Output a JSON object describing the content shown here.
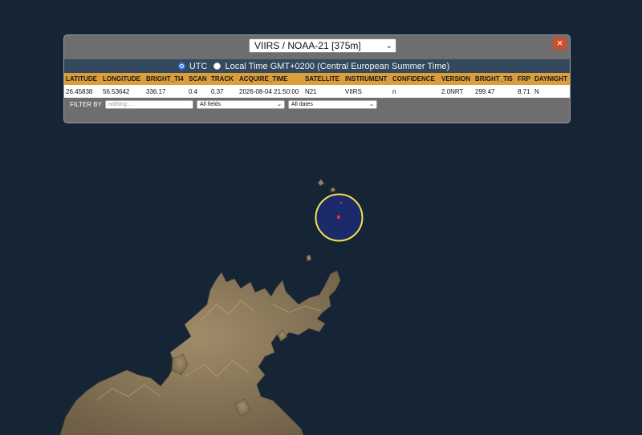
{
  "map": {
    "colors": {
      "water": "#162536",
      "land": "#8b7a5e",
      "marker_ring": "#f2e34a",
      "marker_fill": "#1c2a6b",
      "hotspot": "#e03030"
    }
  },
  "panel": {
    "sensor_select": "VIIRS / NOAA-21 [375m]",
    "close_label": "×",
    "time_utc_label": "UTC",
    "time_local_label": "Local Time GMT+0200 (Central European Summer Time)",
    "time_mode_selected": "UTC",
    "columns": [
      "LATITUDE",
      "LONGITUDE",
      "BRIGHT_TI4",
      "SCAN",
      "TRACK",
      "ACQUIRE_TIME",
      "SATELLITE",
      "INSTRUMENT",
      "CONFIDENCE",
      "VERSION",
      "BRIGHT_TI5",
      "FRP",
      "DAYNIGHT"
    ],
    "row": [
      "26.45838",
      "56.53642",
      "336.17",
      "0.4",
      "0.37",
      "2026-08-04 21:50:00",
      "N21",
      "VIIRS",
      "n",
      "2.0NRT",
      "299.47",
      "8.71",
      "N"
    ],
    "filter_label": "FILTER BY",
    "filter_placeholder": "nothing ...",
    "filter_field": "All fields",
    "filter_dates": "All dates"
  }
}
